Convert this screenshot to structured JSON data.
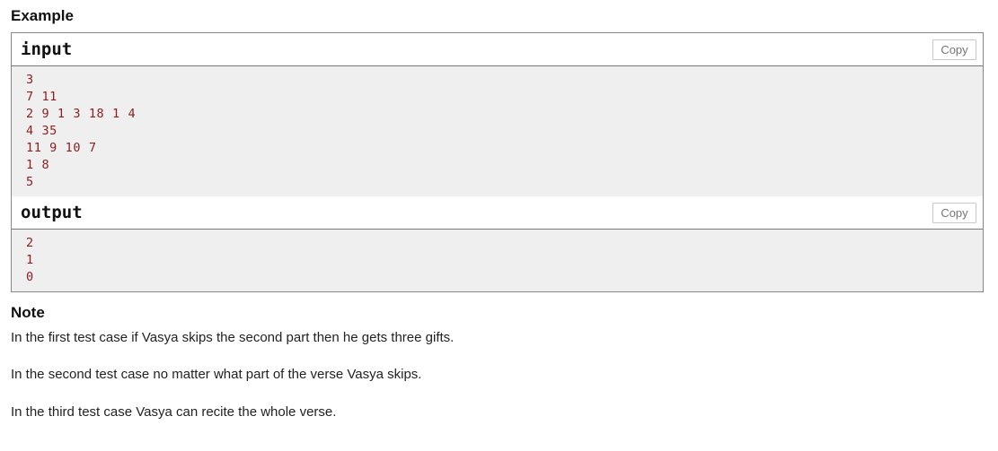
{
  "example": {
    "heading": "Example",
    "input": {
      "label": "input",
      "copy_label": "Copy",
      "lines": [
        "3",
        "7 11",
        "2 9 1 3 18 1 4",
        "4 35",
        "11 9 10 7",
        "1 8",
        "5"
      ]
    },
    "output": {
      "label": "output",
      "copy_label": "Copy",
      "lines": [
        "2",
        "1",
        "0"
      ]
    }
  },
  "note": {
    "heading": "Note",
    "paragraphs": [
      "In the first test case if Vasya skips the second part then he gets three gifts.",
      "In the second test case no matter what part of the verse Vasya skips.",
      "In the third test case Vasya can recite the whole verse."
    ]
  },
  "colors": {
    "code_text": "#8b2020",
    "code_background": "#efefef",
    "border": "#888888",
    "copy_button_text": "#757575",
    "copy_button_border": "#c9c9c9",
    "heading_text": "#111111",
    "body_text": "#222222"
  }
}
